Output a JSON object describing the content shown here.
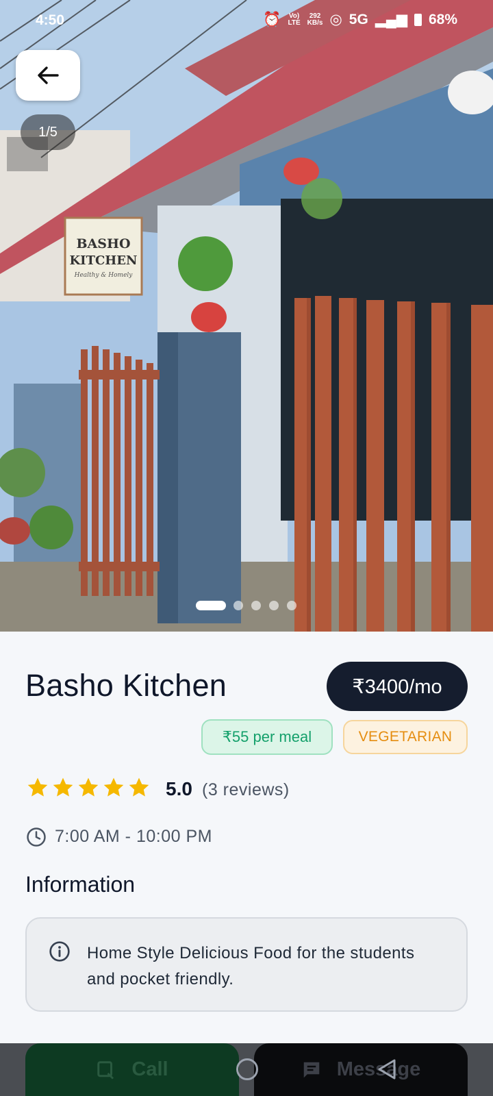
{
  "status_bar": {
    "time": "4:50",
    "network_top": "Vo)",
    "network_bottom": "LTE",
    "speed_top": "292",
    "speed_bottom": "KB/s",
    "signal": "5G",
    "battery": "68%"
  },
  "gallery": {
    "counter": "1/5",
    "photo_count": 5,
    "active_index": 0,
    "sign_line1": "BASHO",
    "sign_line2": "KITCHEN",
    "sign_line3": "Healthy & Homely"
  },
  "listing": {
    "name": "Basho Kitchen",
    "price": "₹3400/mo",
    "meal_price": "₹55 per meal",
    "diet_tag": "VEGETARIAN",
    "rating": "5.0",
    "reviews": "(3 reviews)",
    "star_count": 5,
    "hours": "7:00 AM - 10:00 PM"
  },
  "information": {
    "heading": "Information",
    "text": "Home Style Delicious Food for the students and pocket friendly."
  },
  "actions": {
    "call_label": "Call",
    "message_label": "Message"
  },
  "colors": {
    "price_bg": "#151d2e",
    "meal_tag": "#14a06b",
    "veg_tag": "#e58d10",
    "star": "#f5b800"
  }
}
